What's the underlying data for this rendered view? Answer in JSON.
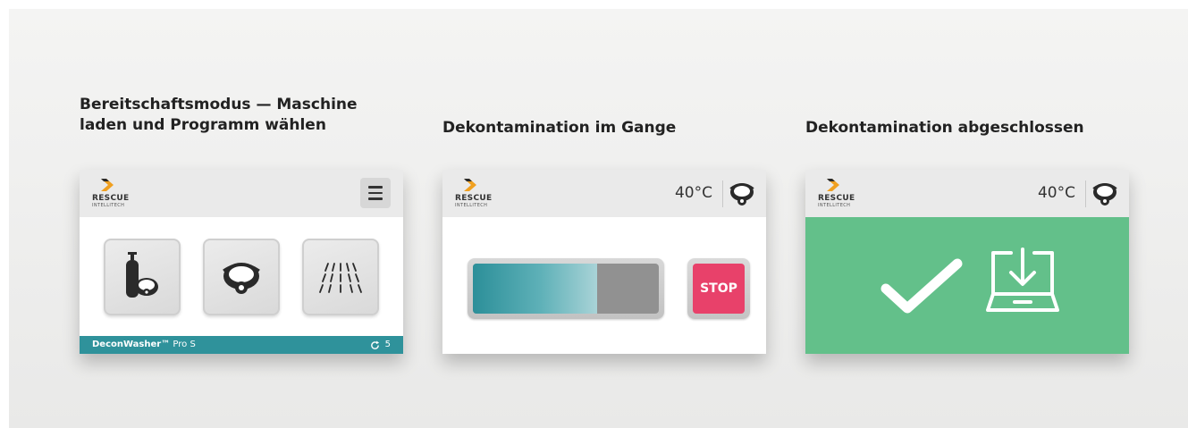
{
  "colors": {
    "accent": "#2f929b",
    "stop": "#e8416a",
    "success": "#63c08a",
    "header": "#eaeaea"
  },
  "brand": {
    "name": "RESCUE",
    "subtitle": "INTELLITECH"
  },
  "panels": [
    {
      "title_line1": "Bereitschaftsmodus — Maschine",
      "title_line2": "laden und Programm wählen",
      "programs": [
        {
          "icon": "oxygen-tank-mask-icon"
        },
        {
          "icon": "respirator-mask-icon"
        },
        {
          "icon": "shower-spray-icon"
        }
      ],
      "footer": {
        "product": "DeconWasher™",
        "model": " Pro S",
        "cycle_icon": "refresh-icon",
        "cycle_count": "5"
      }
    },
    {
      "title": "Dekontamination im Gange",
      "temperature": "40°C",
      "progress": 0.67,
      "stop_label": "STOP"
    },
    {
      "title": "Dekontamination abgeschlossen",
      "temperature": "40°C",
      "icons": [
        "checkmark-icon",
        "unload-tray-icon"
      ]
    }
  ]
}
